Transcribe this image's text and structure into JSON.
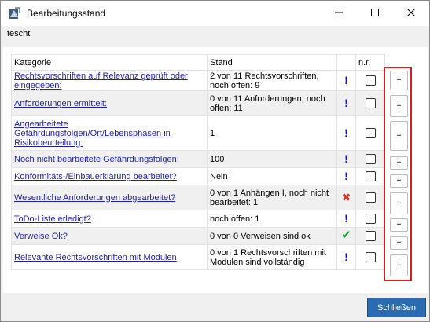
{
  "window": {
    "title": "Bearbeitungsstand",
    "subtitle": "tescht"
  },
  "icons": {
    "app": "app-icon",
    "minimize": "minimize-icon",
    "maximize": "maximize-icon",
    "close": "close-icon"
  },
  "table": {
    "headers": {
      "kategorie": "Kategorie",
      "stand": "Stand",
      "nr": "n.r."
    },
    "rows": [
      {
        "kategorie": "Rechtsvorschriften auf Relevanz geprüft oder eingegeben:",
        "stand": "2 von 11 Rechtsvorschriften, noch offen: 9",
        "status_icon": "exclamation-icon"
      },
      {
        "kategorie": "Anforderungen ermittelt:",
        "stand": "0 von 11 Anforderungen, noch offen: 11",
        "status_icon": "exclamation-icon"
      },
      {
        "kategorie": "Angearbeitete Gefährdungsfolgen/Ort/Lebensphasen in Risikobeurteilung:",
        "stand": "1",
        "status_icon": "exclamation-icon"
      },
      {
        "kategorie": "Noch nicht bearbeitete Gefährdungsfolgen:",
        "stand": "100",
        "status_icon": "exclamation-icon"
      },
      {
        "kategorie": "Konformitäts-/Einbauerklärung bearbeitet?",
        "stand": "Nein",
        "status_icon": "exclamation-icon"
      },
      {
        "kategorie": "Wesentliche Anforderungen abgearbeitet?",
        "stand": "0 von 1 Anhängen I, noch nicht bearbeitet: 1",
        "status_icon": "cross-icon"
      },
      {
        "kategorie": "ToDo-Liste erledigt?",
        "stand": "noch offen: 1",
        "status_icon": "exclamation-icon"
      },
      {
        "kategorie": "Verweise Ok?",
        "stand": "0 von 0 Verweisen sind ok",
        "status_icon": "checkmark-icon"
      },
      {
        "kategorie": "Relevante Rechtsvorschriften mit Modulen",
        "stand": "0 von 1 Rechtsvorschriften mit Modulen sind vollständig",
        "status_icon": "exclamation-icon"
      }
    ],
    "plus_label": "+",
    "highlight_color": "#d62020"
  },
  "footer": {
    "close_label": "Schließen"
  },
  "colors": {
    "link": "#1f1fb4",
    "exclamation": "#1212d6",
    "cross": "#d33a2f",
    "check": "#1c9a2a",
    "primary_button": "#2a6bb1"
  }
}
